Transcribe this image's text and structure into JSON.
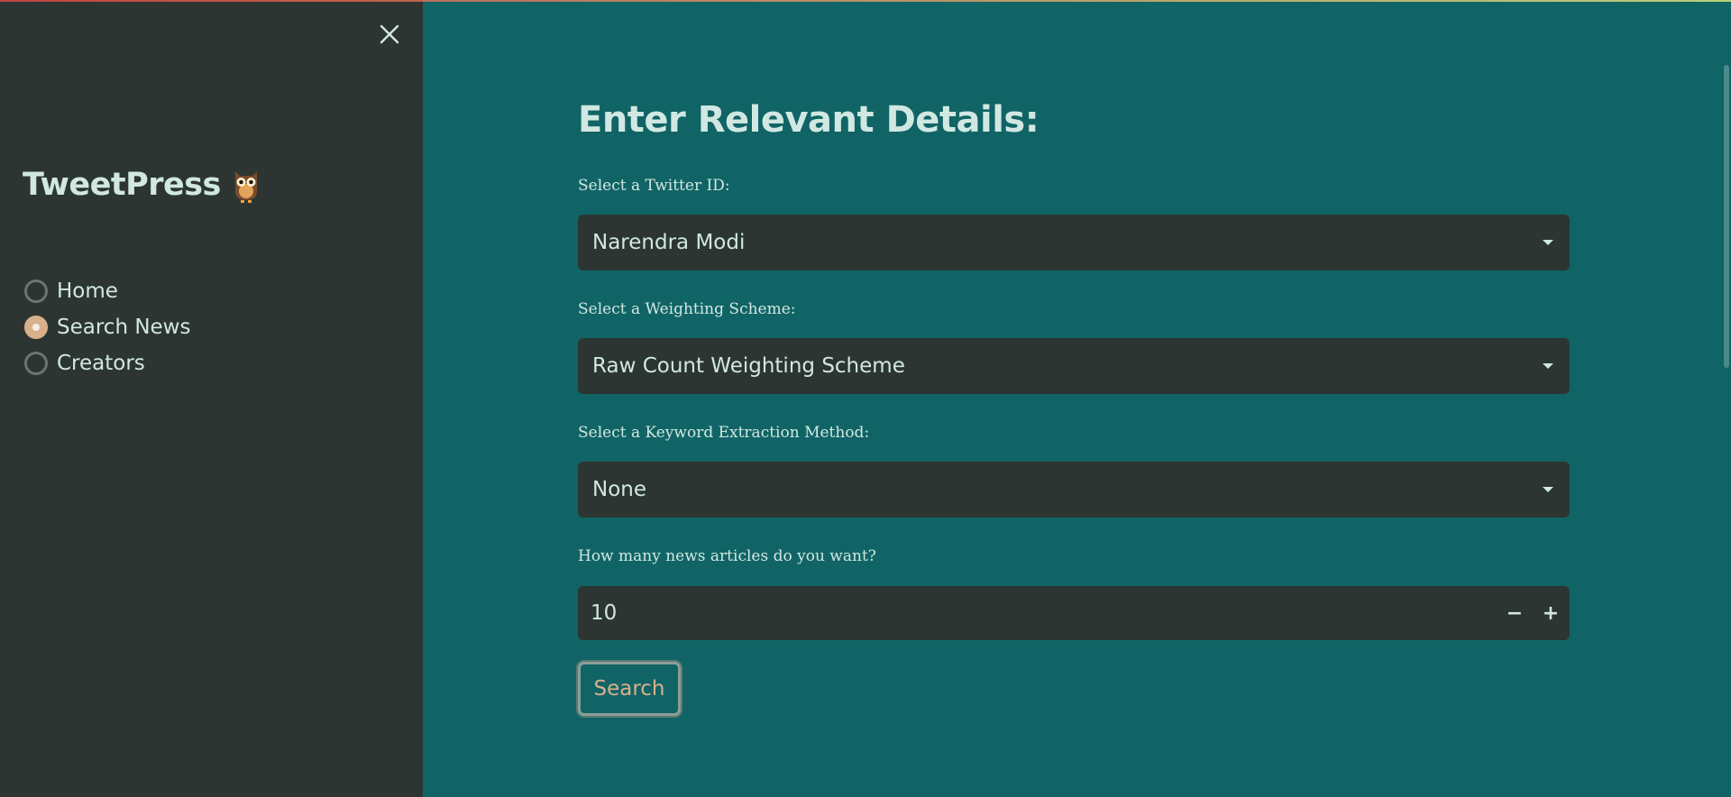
{
  "theme": {
    "main_bg": "#116466",
    "sidebar_bg": "#2c3531",
    "text": "#d1e8e2",
    "accent": "#d9b08c"
  },
  "sidebar": {
    "close_icon": "close-icon",
    "brand_title": "TweetPress",
    "brand_icon": "owl-icon",
    "nav_items": [
      {
        "label": "Home",
        "selected": false
      },
      {
        "label": "Search News",
        "selected": true
      },
      {
        "label": "Creators",
        "selected": false
      }
    ]
  },
  "main": {
    "title": "Enter Relevant Details:",
    "twitter_id": {
      "label": "Select a Twitter ID:",
      "value": "Narendra Modi"
    },
    "weighting": {
      "label": "Select a Weighting Scheme:",
      "value": "Raw Count Weighting Scheme"
    },
    "keyword": {
      "label": "Select a Keyword Extraction Method:",
      "value": "None"
    },
    "articles": {
      "label": "How many news articles do you want?",
      "value": "10",
      "minus": "−",
      "plus": "+"
    },
    "search_label": "Search"
  }
}
